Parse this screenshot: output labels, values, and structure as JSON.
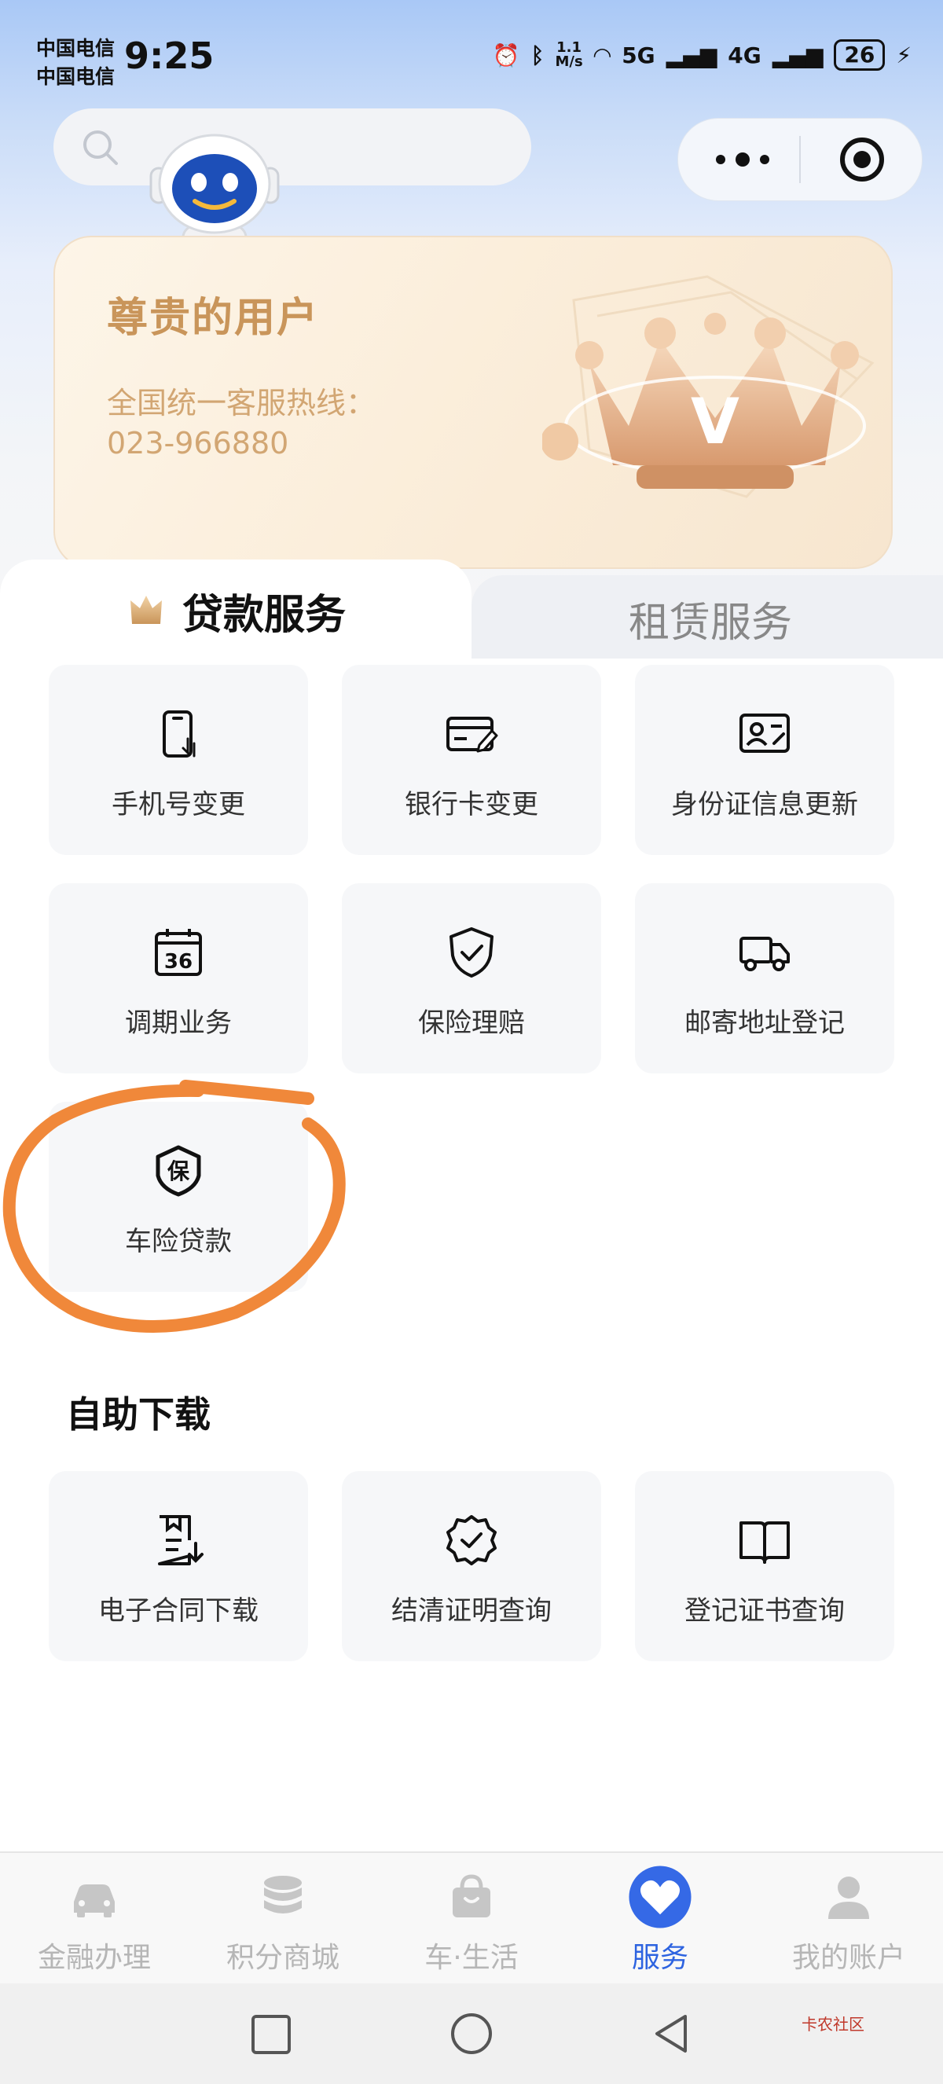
{
  "status_bar": {
    "carrier1": "中国电信",
    "carrier2": "中国电信",
    "time": "9:25",
    "speed_top": "1.1",
    "speed_bottom": "M/s",
    "net1": "5G",
    "net2": "4G",
    "battery": "26"
  },
  "header": {
    "search_placeholder": ""
  },
  "vip_card": {
    "title": "尊贵的用户",
    "hotline_label": "全国统一客服热线：",
    "hotline_number": "023-966880",
    "crown_letter": "V"
  },
  "tabs": {
    "active": "贷款服务",
    "inactive": "租赁服务"
  },
  "services": [
    {
      "label": "手机号变更",
      "icon": "phone-change-icon"
    },
    {
      "label": "银行卡变更",
      "icon": "bank-card-icon"
    },
    {
      "label": "身份证信息更新",
      "icon": "id-card-icon"
    },
    {
      "label": "调期业务",
      "icon": "calendar-36-icon"
    },
    {
      "label": "保险理赔",
      "icon": "shield-check-icon"
    },
    {
      "label": "邮寄地址登记",
      "icon": "truck-icon"
    },
    {
      "label": "车险贷款",
      "icon": "insurance-badge-icon"
    }
  ],
  "insurance_badge_char": "保",
  "calendar_number": "36",
  "self_service": {
    "title": "自助下载",
    "items": [
      {
        "label": "电子合同下载",
        "icon": "contract-download-icon"
      },
      {
        "label": "结清证明查询",
        "icon": "settlement-badge-icon"
      },
      {
        "label": "登记证书查询",
        "icon": "book-icon"
      }
    ]
  },
  "bottom_nav": [
    {
      "label": "金融办理",
      "icon": "car-icon",
      "active": false
    },
    {
      "label": "积分商城",
      "icon": "coins-icon",
      "active": false
    },
    {
      "label": "车·生活",
      "icon": "gift-bag-icon",
      "active": false
    },
    {
      "label": "服务",
      "icon": "heart-icon",
      "active": true
    },
    {
      "label": "我的账户",
      "icon": "user-icon",
      "active": false
    }
  ],
  "watermark": "卡农社区",
  "colors": {
    "gold_text": "#c9955a",
    "active_blue": "#2d63e0",
    "annotation_orange": "#f0883a"
  }
}
